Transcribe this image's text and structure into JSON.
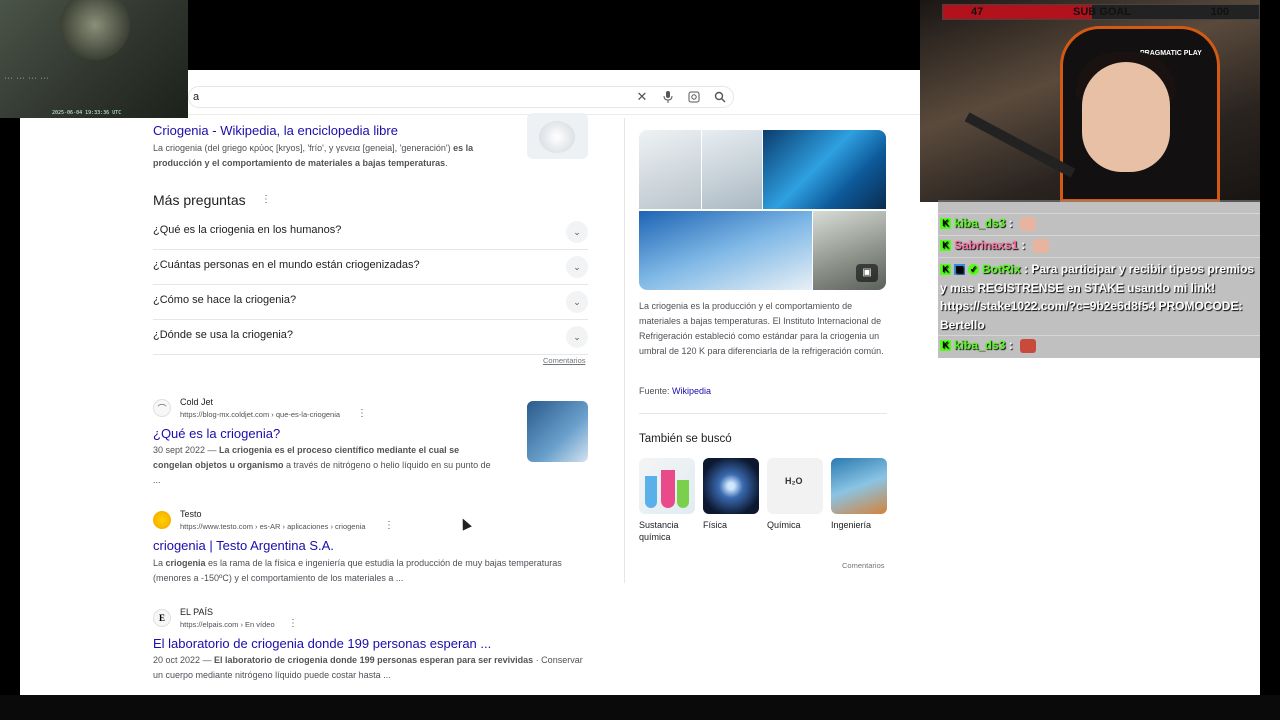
{
  "search": {
    "query": "a"
  },
  "stream": {
    "subgoal": {
      "current": "47",
      "label": "SUB GOAL",
      "target": "100",
      "progress": 0.47
    },
    "cam_timestamp": "2025-06-04 19:33:36 UTC",
    "chair_logo": "PRAGMATIC PLAY"
  },
  "chat": [
    {
      "user": "kiba_ds3",
      "text": ""
    },
    {
      "user": "Sabrinaxs1",
      "text": ""
    },
    {
      "user": "BotRix",
      "text": "Para participar y recibir tipeos premios y mas REGISTRENSE en STAKE usando mi link! https://stake1022.com/?c=9b2e6d8f54 PROMOCODE: Bertello"
    },
    {
      "user": "kiba_ds3",
      "text": ""
    }
  ],
  "results": {
    "wiki": {
      "title": "Criogenia - Wikipedia, la enciclopedia libre",
      "snippet_plain1": "La criogenia (del griego κρύος [kryos], 'frío', y γενεια [geneia], 'generación') ",
      "snippet_bold": "es la producción y el comportamiento de materiales a bajas temperaturas",
      "snippet_end": "."
    },
    "more_questions": {
      "title": "Más preguntas",
      "items": [
        "¿Qué es la criogenia en los humanos?",
        "¿Cuántas personas en el mundo están criogenizadas?",
        "¿Cómo se hace la criogenia?",
        "¿Dónde se usa la criogenia?"
      ],
      "feedback": "Comentarios"
    },
    "coldjet": {
      "source": "Cold Jet",
      "url": "https://blog-mx.coldjet.com › que-es-la-criogenia",
      "title": "¿Qué es la criogenia?",
      "date": "30 sept 2022 — ",
      "snippet_bold": "La criogenia es el proceso científico mediante el cual se congelan objetos u organismo",
      "snippet_end": " a través de nitrógeno o helio líquido en su punto de ..."
    },
    "testo": {
      "source": "Testo",
      "url": "https://www.testo.com › es-AR › aplicaciones › criogenia",
      "title": "criogenia | Testo Argentina S.A.",
      "snippet_a": "La ",
      "snippet_bold": "criogenia",
      "snippet_b": " es la rama de la física e ingeniería que estudia la producción de muy bajas temperaturas (menores a -150ºC) y el comportamiento de los materiales a ..."
    },
    "elpais": {
      "source": "EL PAÍS",
      "url": "https://elpais.com › En vídeo",
      "title": "El laboratorio de criogenia donde 199 personas esperan ...",
      "date": "20 oct 2022 — ",
      "snippet_bold": "El laboratorio de criogenia donde 199 personas esperan para ser revividas",
      "snippet_end": " · Conservar un cuerpo mediante nitrógeno líquido puede costar hasta ..."
    }
  },
  "knowledge_panel": {
    "description": "La criogenia es la producción y el comportamiento de materiales a bajas temperaturas. El Instituto Internacional de Refrigeración estableció como estándar para la criogenia un umbral de 120 K para diferenciarla de la refrigeración común.",
    "source_label": "Fuente: ",
    "source_link": "Wikipedia",
    "also_searched": "También se buscó",
    "related": [
      "Sustancia química",
      "Física",
      "Química",
      "Ingeniería"
    ],
    "feedback": "Comentarios"
  },
  "colors": {
    "link": "#1a0dab",
    "kick_green": "#53fc18",
    "subgoal_red": "#b3121c"
  }
}
